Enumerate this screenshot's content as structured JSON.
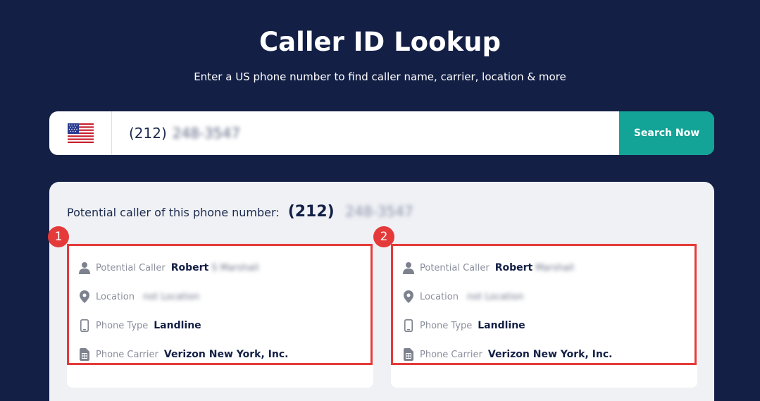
{
  "header": {
    "title": "Caller ID Lookup",
    "subtitle": "Enter a US phone number to find caller name, carrier, location & more"
  },
  "search": {
    "country_icon": "us-flag-icon",
    "area_code": "(212)",
    "number_rest": "248-3547",
    "button_label": "Search Now"
  },
  "results": {
    "heading_label": "Potential caller of this phone number:",
    "heading_area_code": "(212)",
    "heading_number_rest": "248-3547",
    "cards": [
      {
        "badge": "1",
        "caller_label": "Potential Caller",
        "caller_first": "Robert",
        "caller_rest": "S Marshall",
        "location_label": "Location",
        "location_value": "not Location",
        "phone_type_label": "Phone Type",
        "phone_type_value": "Landline",
        "carrier_label": "Phone Carrier",
        "carrier_value": "Verizon New York, Inc."
      },
      {
        "badge": "2",
        "caller_label": "Potential Caller",
        "caller_first": "Robert",
        "caller_rest": "Marshall",
        "location_label": "Location",
        "location_value": "not Location",
        "phone_type_label": "Phone Type",
        "phone_type_value": "Landline",
        "carrier_label": "Phone Carrier",
        "carrier_value": "Verizon New York, Inc."
      }
    ]
  },
  "colors": {
    "background": "#131f45",
    "accent": "#13a397",
    "highlight": "#e53a3a",
    "panel": "#eff1f5"
  }
}
